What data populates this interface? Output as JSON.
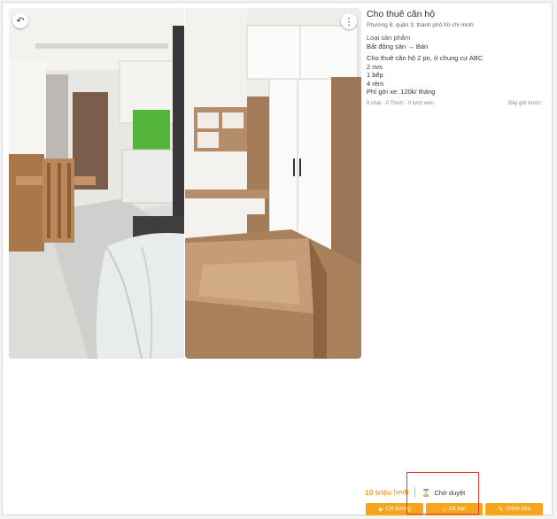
{
  "listing": {
    "title": "Cho thuê căn hộ",
    "address": "Phường 8, quận 3, thành phố hồ chí minh",
    "category_label": "Loại sản phẩm",
    "category_value": "Bất động sản → Bán",
    "description_lines": [
      "Cho thuê căn hộ 2 pn, ở chung cư ABC",
      "2 nvs",
      "1 bếp",
      "4 rèm",
      "Phí gởi xe: 120k/ tháng"
    ],
    "stats": "0 chat · 0 Thích · 0 lượt xem",
    "time": "Bây giờ trước"
  },
  "price": {
    "value": "10 triệu",
    "unit": "(vnđ)"
  },
  "status": {
    "icon": "hourglass-icon",
    "label": "Chờ duyệt"
  },
  "actions": [
    {
      "label": "Chỉ đường",
      "icon": "direction-icon"
    },
    {
      "label": "Đã bán",
      "icon": "tag-icon"
    },
    {
      "label": "Chỉnh sửa",
      "icon": "edit-icon"
    }
  ],
  "colors": {
    "accent": "#f6a61c",
    "highlight": "#e53935"
  }
}
